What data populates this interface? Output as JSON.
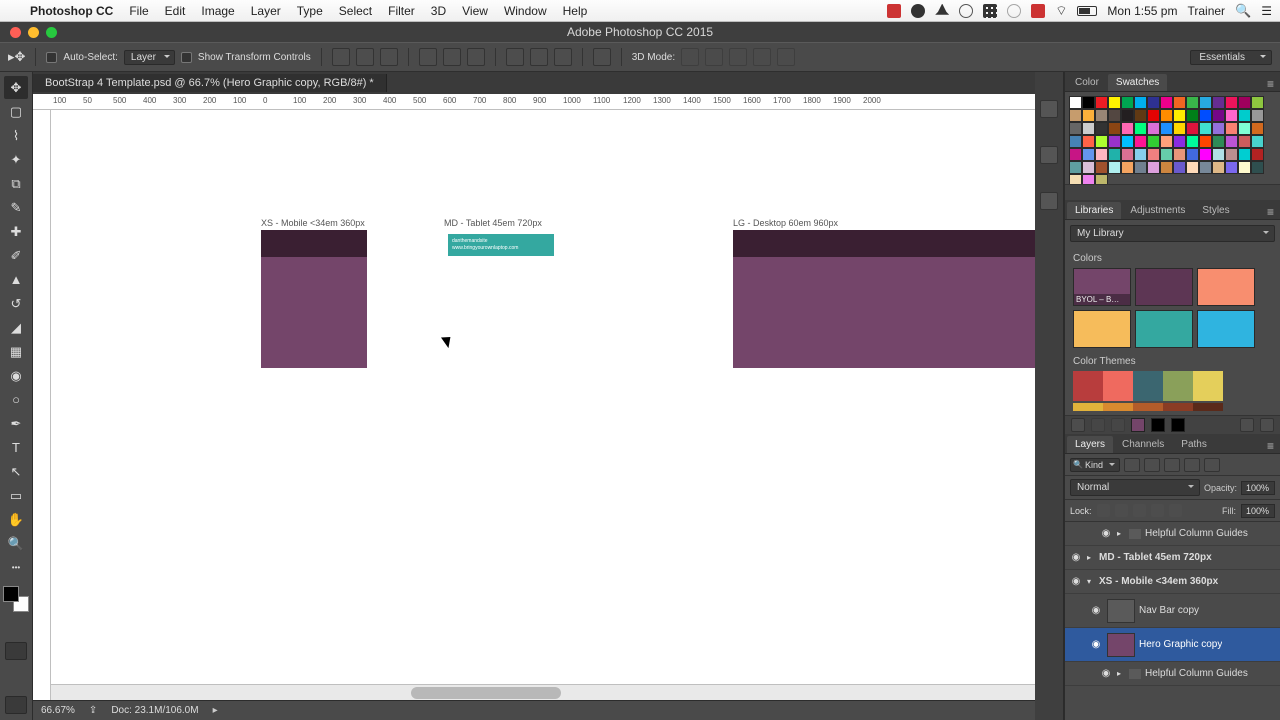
{
  "menubar": {
    "app": "Photoshop CC",
    "items": [
      "File",
      "Edit",
      "Image",
      "Layer",
      "Type",
      "Select",
      "Filter",
      "3D",
      "View",
      "Window",
      "Help"
    ],
    "clock": "Mon 1:55 pm",
    "user": "Trainer"
  },
  "window": {
    "title": "Adobe Photoshop CC 2015"
  },
  "options": {
    "auto_select": "Auto-Select:",
    "auto_select_target": "Layer",
    "show_transform": "Show Transform Controls",
    "mode3d": "3D Mode:",
    "workspace": "Essentials"
  },
  "document": {
    "tab": "BootStrap 4 Template.psd @ 66.7% (Hero Graphic copy, RGB/8#) *",
    "ruler_ticks": [
      "100",
      "50",
      "500",
      "400",
      "300",
      "200",
      "100",
      "0",
      "100",
      "200",
      "300",
      "400",
      "500",
      "600",
      "700",
      "800",
      "900",
      "1000",
      "1100",
      "1200",
      "1300",
      "1400",
      "1500",
      "1600",
      "1700",
      "1800",
      "1900",
      "2000"
    ]
  },
  "artboards": {
    "xs_label": "XS - Mobile <34em 360px",
    "md_label": "MD - Tablet 45em 720px",
    "lg_label": "LG - Desktop 60em 960px",
    "md_nav_line1": "danthemandsite",
    "md_nav_line2": "www.bringyourownlaptop.com"
  },
  "status": {
    "zoom": "66.67%",
    "doc": "Doc: 23.1M/106.0M"
  },
  "panels": {
    "color_tab": "Color",
    "swatches_tab": "Swatches",
    "libraries_tab": "Libraries",
    "adjustments_tab": "Adjustments",
    "styles_tab": "Styles",
    "my_library": "My Library",
    "colors_h": "Colors",
    "byol": "BYOL – B…",
    "color_themes_h": "Color Themes",
    "layers_tab": "Layers",
    "channels_tab": "Channels",
    "paths_tab": "Paths",
    "kind": "Kind",
    "blend": "Normal",
    "opacity_l": "Opacity:",
    "opacity_v": "100%",
    "lock_l": "Lock:",
    "fill_l": "Fill:",
    "fill_v": "100%"
  },
  "layers": {
    "l0": "Helpful Column Guides",
    "l1": "MD - Tablet 45em 720px",
    "l2": "XS - Mobile <34em 360px",
    "l3": "Nav Bar copy",
    "l4": "Hero Graphic copy",
    "l5": "Helpful Column Guides"
  },
  "swatch_colors": [
    "#fff",
    "#000",
    "#ed1c24",
    "#fff200",
    "#00a651",
    "#00aeef",
    "#2e3192",
    "#ec008c",
    "#f26522",
    "#39b54a",
    "#27aae1",
    "#662d91",
    "#ed145b",
    "#9e005d",
    "#8dc63f",
    "#c69c6d",
    "#fbb03b",
    "#998675",
    "#534741",
    "#231f20",
    "#603913"
  ],
  "swatch_grid": [
    "#e40303",
    "#ff8c00",
    "#ffed00",
    "#008018",
    "#004dff",
    "#750787",
    "#ff66cc",
    "#00cccc",
    "#999",
    "#666",
    "#ccc",
    "#333",
    "#8b4513",
    "#ff69b4",
    "#00ff7f",
    "#da70d6",
    "#1e90ff",
    "#ffd700",
    "#dc143c",
    "#40e0d0",
    "#9370db",
    "#fa8072",
    "#7fffd4",
    "#d2691e",
    "#4682b4",
    "#ff6347",
    "#adff2f",
    "#9932cc",
    "#00bfff",
    "#ff1493",
    "#32cd32",
    "#ffa07a",
    "#8a2be2",
    "#00fa9a",
    "#ff4500",
    "#2e8b57",
    "#ba55d3",
    "#cd5c5c",
    "#48d1cc",
    "#c71585",
    "#6495ed",
    "#ffb6c1",
    "#20b2aa",
    "#db7093",
    "#87ceeb",
    "#f08080",
    "#66cdaa",
    "#e9967a",
    "#4169e1",
    "#ff00ff",
    "#b0e0e6",
    "#bc8f8f",
    "#00ced1",
    "#b22222",
    "#5f9ea0",
    "#d8bfd8",
    "#a0522d",
    "#afeeee",
    "#f4a460",
    "#708090",
    "#dda0dd",
    "#cd853f",
    "#6a5acd",
    "#ffdab9",
    "#778899",
    "#deb887",
    "#7b68ee",
    "#fffacd",
    "#2f4f4f",
    "#f5deb3",
    "#ee82ee",
    "#bdb76b"
  ],
  "lib_colors": {
    "c1": "#74456a",
    "c2": "#5d3654",
    "c3": "#f88e6f",
    "c4": "#f6bc5b",
    "c5": "#34a8a0",
    "c6": "#2fb4e0"
  },
  "themes": {
    "t1": "#b83d3d",
    "t2": "#ef6a5f",
    "t3": "#3b6670",
    "t4": "#8aa05a",
    "t5": "#e4cf5b",
    "b1": "#e2b33b",
    "b2": "#d98a2f",
    "b3": "#b35c2a",
    "b4": "#8a3c24",
    "b5": "#5a2a1a"
  }
}
